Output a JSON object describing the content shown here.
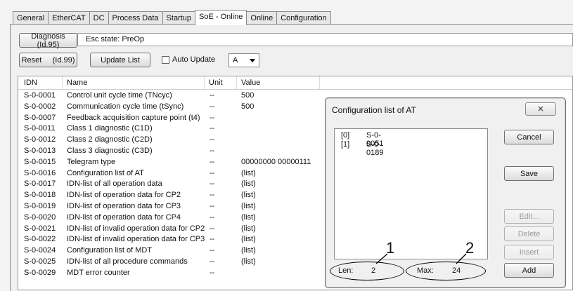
{
  "tabs": [
    "General",
    "EtherCAT",
    "DC",
    "Process Data",
    "Startup",
    "SoE - Online",
    "Online",
    "Configuration"
  ],
  "active_tab": "SoE - Online",
  "toolbar": {
    "diagnosis_label": "Diagnosis (Id.95)",
    "esc_state": "Esc state: PreOp",
    "reset_label": "Reset     (Id.99)",
    "update_label": "Update List",
    "auto_update_label": "Auto Update",
    "auto_update_checked": false,
    "drive_select": "A"
  },
  "table": {
    "headers": [
      "IDN",
      "Name",
      "Unit",
      "Value"
    ],
    "rows": [
      [
        "S-0-0001",
        "Control unit cycle time (TNcyc)",
        "--",
        "500"
      ],
      [
        "S-0-0002",
        "Communication cycle time (tSync)",
        "--",
        "500"
      ],
      [
        "S-0-0007",
        "Feedback acquisition capture point (t4)",
        "--",
        ""
      ],
      [
        "S-0-0011",
        "Class 1 diagnostic (C1D)",
        "--",
        ""
      ],
      [
        "S-0-0012",
        "Class 2 diagnostic (C2D)",
        "--",
        ""
      ],
      [
        "S-0-0013",
        "Class 3 diagnostic (C3D)",
        "--",
        ""
      ],
      [
        "S-0-0015",
        "Telegram type",
        "--",
        "00000000 00000111"
      ],
      [
        "S-0-0016",
        "Configuration list of AT",
        "--",
        "(list)"
      ],
      [
        "S-0-0017",
        "IDN-list of all operation data",
        "--",
        "(list)"
      ],
      [
        "S-0-0018",
        "IDN-list of operation data for CP2",
        "--",
        "(list)"
      ],
      [
        "S-0-0019",
        "IDN-list of operation data for CP3",
        "--",
        "(list)"
      ],
      [
        "S-0-0020",
        "IDN-list of operation data for CP4",
        "--",
        "(list)"
      ],
      [
        "S-0-0021",
        "IDN-list of invalid operation data for CP2",
        "--",
        "(list)"
      ],
      [
        "S-0-0022",
        "IDN-list of invalid operation data for CP3",
        "--",
        "(list)"
      ],
      [
        "S-0-0024",
        "Configuration list of MDT",
        "--",
        "(list)"
      ],
      [
        "S-0-0025",
        "IDN-list of all procedure commands",
        "--",
        "(list)"
      ],
      [
        "S-0-0029",
        "MDT error counter",
        "--",
        ""
      ]
    ]
  },
  "dialog": {
    "title": "Configuration list of AT",
    "close_glyph": "☒",
    "list": [
      {
        "index": "[0]",
        "idn": "S-0-0051"
      },
      {
        "index": "[1]",
        "idn": "S-0-0189"
      }
    ],
    "cancel_label": "Cancel",
    "save_label": "Save",
    "edit_label": "Edit...",
    "delete_label": "Delete",
    "insert_label": "Insert",
    "add_label": "Add",
    "len_label": "Len:",
    "len_value": "2",
    "max_label": "Max:",
    "max_value": "24",
    "callout_1": "1",
    "callout_2": "2"
  }
}
